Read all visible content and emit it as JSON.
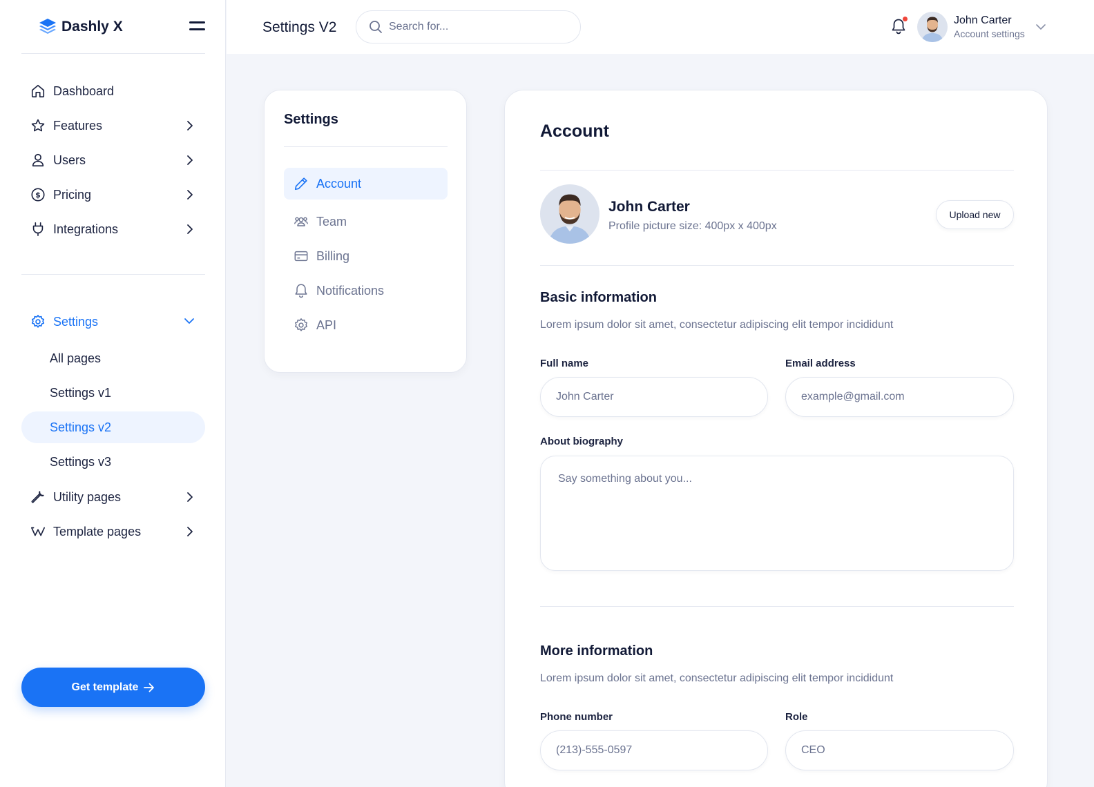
{
  "brand": {
    "name": "Dashly X"
  },
  "sidebar": {
    "items": [
      {
        "label": "Dashboard",
        "icon": "home-icon"
      },
      {
        "label": "Features",
        "icon": "star-icon"
      },
      {
        "label": "Users",
        "icon": "user-icon"
      },
      {
        "label": "Pricing",
        "icon": "dollar-icon"
      },
      {
        "label": "Integrations",
        "icon": "plug-icon"
      }
    ],
    "settings": {
      "label": "Settings",
      "icon": "gear-icon",
      "children": [
        "All pages",
        "Settings v1",
        "Settings v2",
        "Settings v3"
      ],
      "current": "Settings v2"
    },
    "more_items": [
      {
        "label": "Utility pages",
        "icon": "wrench-icon"
      },
      {
        "label": "Template pages",
        "icon": "webflow-icon"
      }
    ],
    "cta": "Get template"
  },
  "header": {
    "title": "Settings V2",
    "search_placeholder": "Search for...",
    "user": {
      "name": "John Carter",
      "subtitle": "Account settings"
    }
  },
  "settings_nav": {
    "title": "Settings",
    "items": [
      {
        "label": "Account",
        "icon": "pencil-icon",
        "active": true
      },
      {
        "label": "Team",
        "icon": "team-icon"
      },
      {
        "label": "Billing",
        "icon": "card-icon"
      },
      {
        "label": "Notifications",
        "icon": "bell-icon"
      },
      {
        "label": "API",
        "icon": "gear-icon"
      }
    ]
  },
  "account": {
    "title": "Account",
    "profile": {
      "name": "John Carter",
      "hint": "Profile picture size: 400px x 400px",
      "upload_label": "Upload new"
    },
    "basic": {
      "title": "Basic information",
      "desc": "Lorem ipsum dolor sit amet, consectetur adipiscing elit tempor incididunt",
      "full_name_label": "Full name",
      "full_name_placeholder": "John Carter",
      "email_label": "Email address",
      "email_placeholder": "example@gmail.com",
      "bio_label": "About biography",
      "bio_placeholder": "Say something about you..."
    },
    "more": {
      "title": "More information",
      "desc": "Lorem ipsum dolor sit amet, consectetur adipiscing elit tempor incididunt",
      "phone_label": "Phone number",
      "phone_placeholder": "(213)-555-0597",
      "role_label": "Role",
      "role_placeholder": "CEO"
    }
  },
  "colors": {
    "accent": "#1a73f5",
    "active_bg": "#eef4ff",
    "page_bg": "#f3f5fa",
    "notification_dot": "#f0453a"
  }
}
